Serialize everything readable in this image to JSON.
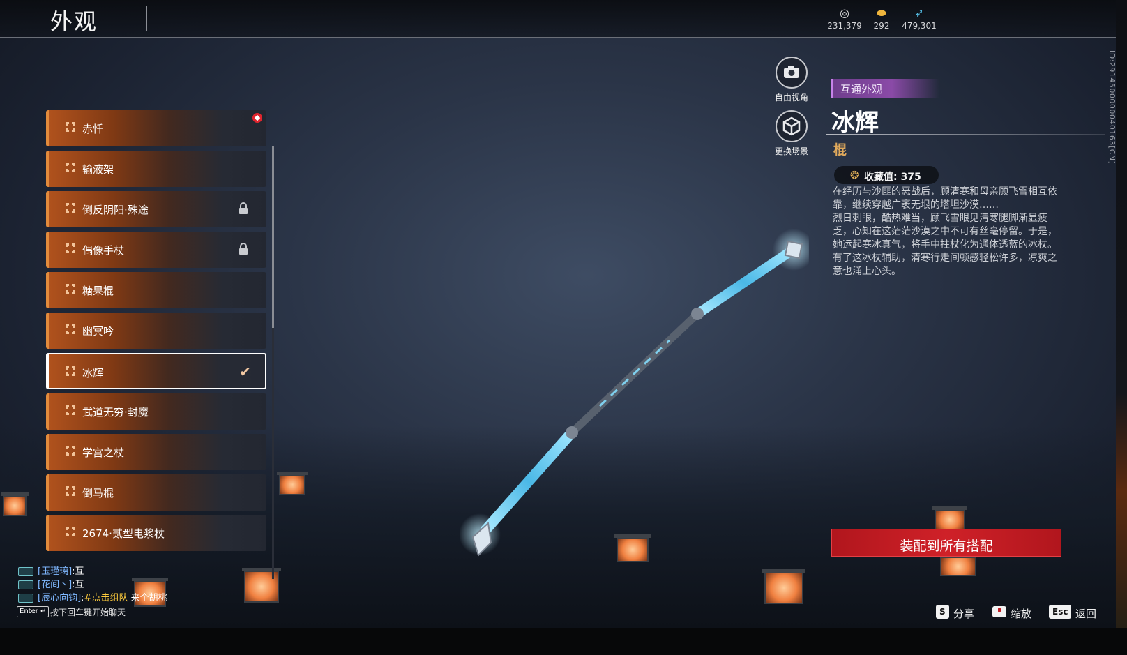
{
  "header": {
    "title": "外观",
    "currencies": [
      {
        "icon": "silver-coin-icon",
        "value": "231,379"
      },
      {
        "icon": "gold-ingot-icon",
        "value": "292"
      },
      {
        "icon": "feather-icon",
        "value": "479,301"
      }
    ]
  },
  "list": {
    "items": [
      {
        "label": "赤忏",
        "state": "new"
      },
      {
        "label": "输液架",
        "state": "normal"
      },
      {
        "label": "倒反阴阳·殊途",
        "state": "locked"
      },
      {
        "label": "偶像手杖",
        "state": "locked"
      },
      {
        "label": "糖果棍",
        "state": "normal"
      },
      {
        "label": "幽冥吟",
        "state": "normal"
      },
      {
        "label": "冰辉",
        "state": "selected"
      },
      {
        "label": "武道无穷·封魔",
        "state": "normal"
      },
      {
        "label": "学宫之杖",
        "state": "normal"
      },
      {
        "label": "倒马棍",
        "state": "normal"
      },
      {
        "label": "2674·贰型电浆杖",
        "state": "normal"
      }
    ]
  },
  "camera": {
    "free_view_label": "自由视角",
    "change_scene_label": "更换场景"
  },
  "item": {
    "tag": "互通外观",
    "name": "冰辉",
    "type": "棍",
    "collection_label": "收藏值: 375",
    "description": [
      "在经历与沙匪的恶战后，顾清寒和母亲顾飞雪相互依靠，继续穿越广袤无垠的塔坦沙漠……",
      "烈日刺眼，酷热难当，顾飞雪眼见清寒腿脚渐显疲乏，心知在这茫茫沙漠之中不可有丝毫停留。于是，她运起寒冰真气，将手中拄杖化为通体透蓝的冰杖。",
      "有了这冰杖辅助，清寒行走间顿感轻松许多，凉爽之意也涌上心头。"
    ],
    "id_text": "ID:2914500000040163[CN]"
  },
  "equip_button_label": "装配到所有搭配",
  "hints": {
    "share_key": "S",
    "share_label": "分享",
    "zoom_label": "缩放",
    "back_key": "Esc",
    "back_label": "返回"
  },
  "chat": {
    "lines": [
      {
        "name": "[玉瑾璃]",
        "msg": ":互",
        "link": ""
      },
      {
        "name": "[花间丶]",
        "msg": ":互",
        "link": ""
      },
      {
        "name": "[辰心向钧]",
        "msg": ":",
        "link": "#点击组队",
        "tail": "来个胡桃"
      }
    ],
    "enter_key": "Enter ↵",
    "enter_hint": "按下回车键开始聊天"
  },
  "colors": {
    "accent_orange": "#e28b3c",
    "tag_purple": "#8a4aa7",
    "equip_red": "#cf2128",
    "type_gold": "#e0a95c"
  }
}
